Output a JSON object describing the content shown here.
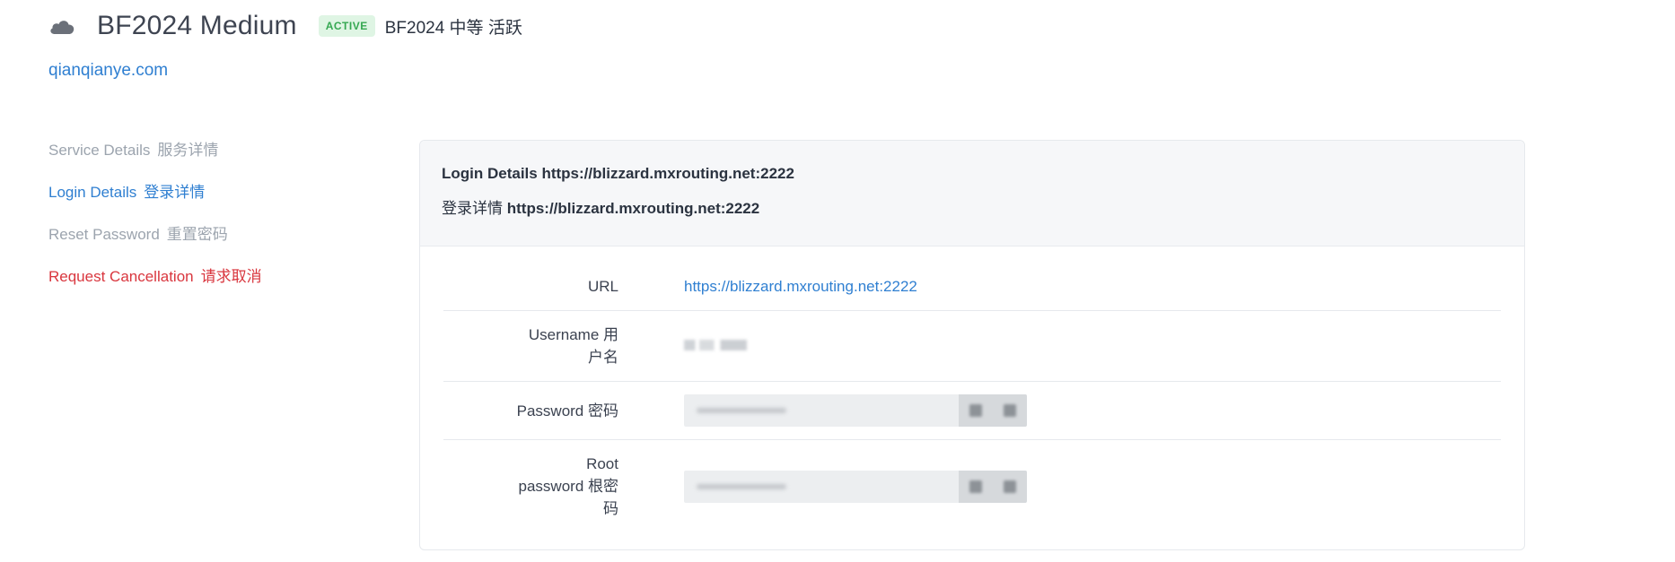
{
  "header": {
    "title": "BF2024 Medium",
    "status_badge": "ACTIVE",
    "subtitle": "BF2024 中等 活跃",
    "domain": "qianqianye.com",
    "icon": "cloud-icon"
  },
  "sidebar": {
    "items": [
      {
        "label": "Service Details",
        "label_zh": "服务详情",
        "state": "muted"
      },
      {
        "label": "Login Details",
        "label_zh": "登录详情",
        "state": "active"
      },
      {
        "label": "Reset Password",
        "label_zh": "重置密码",
        "state": "muted"
      },
      {
        "label": "Request Cancellation",
        "label_zh": "请求取消",
        "state": "danger"
      }
    ]
  },
  "panel": {
    "header_line1_label": "Login Details",
    "header_line1_url": "https://blizzard.mxrouting.net:2222",
    "header_line2_label": "登录详情",
    "header_line2_url": "https://blizzard.mxrouting.net:2222",
    "rows": {
      "url": {
        "label": "URL",
        "value": "https://blizzard.mxrouting.net:2222"
      },
      "username": {
        "label_line1": "Username 用",
        "label_line2": "户名"
      },
      "password": {
        "label": "Password 密码"
      },
      "root_password": {
        "label_line1": "Root",
        "label_line2": "password 根密",
        "label_line3": "码"
      }
    }
  },
  "colors": {
    "accent": "#2f7fd1",
    "danger": "#d9363e",
    "badge_bg": "#dff5e4",
    "badge_text": "#36a852"
  }
}
